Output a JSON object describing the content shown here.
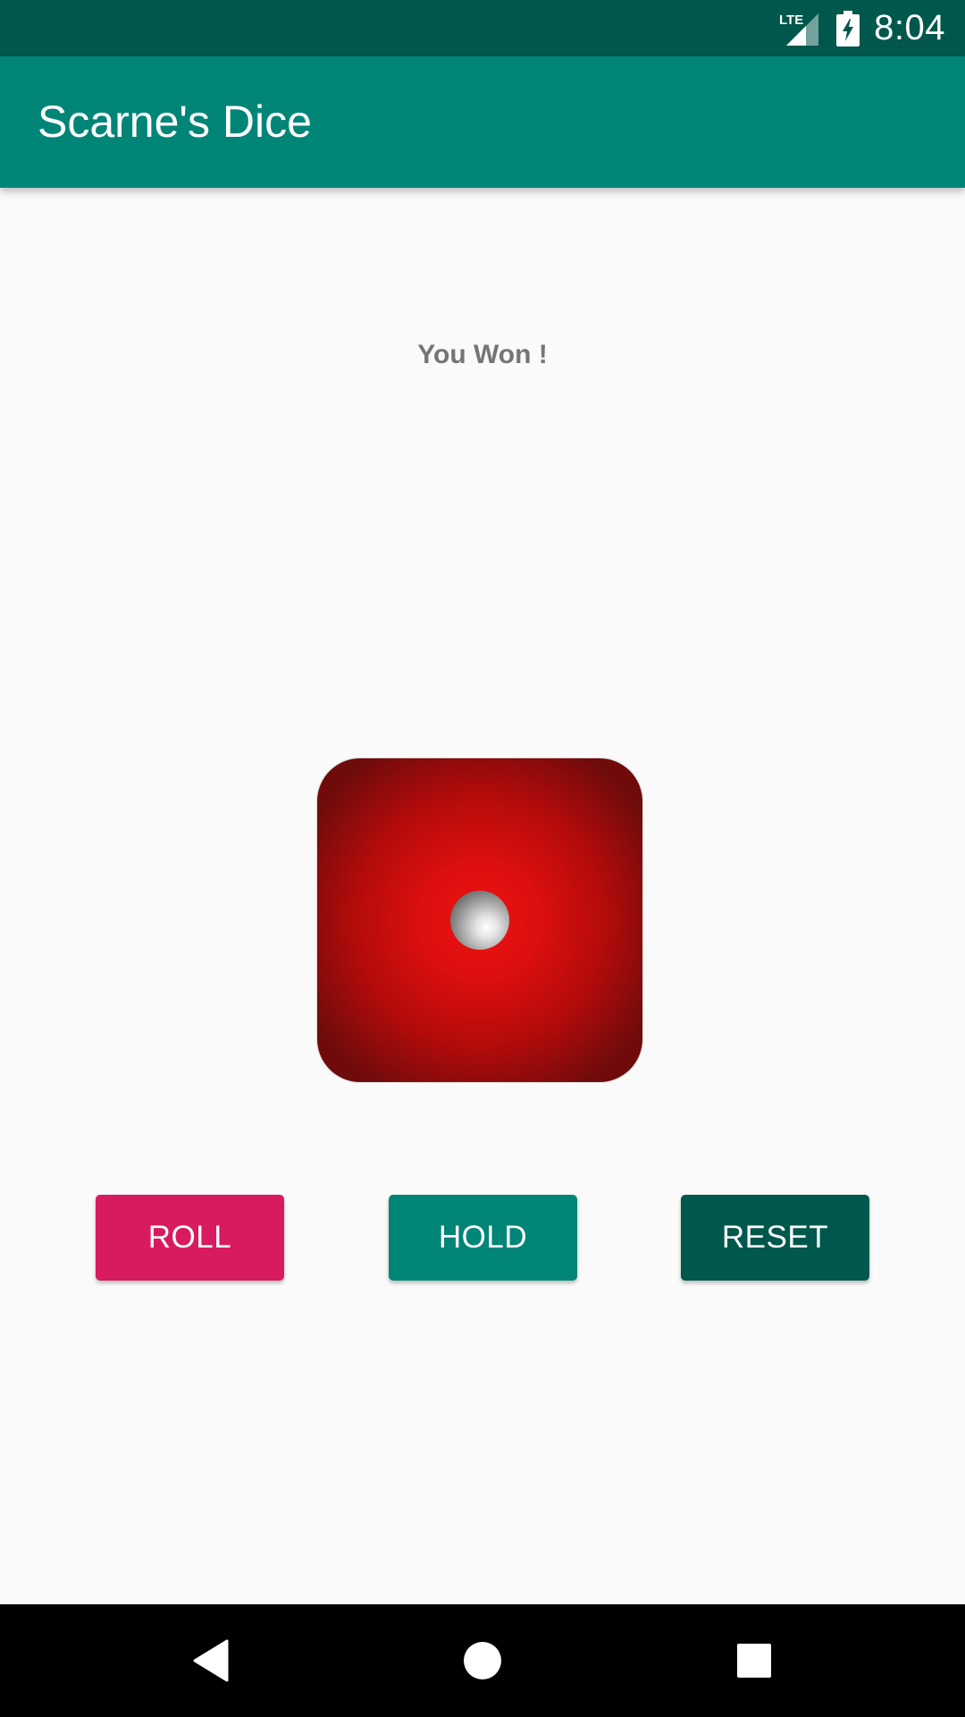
{
  "status_bar": {
    "network_label": "LTE",
    "time": "8:04"
  },
  "app_bar": {
    "title": "Scarne's Dice"
  },
  "game": {
    "status_message": "You Won !",
    "die_face": 1,
    "die_color": "#e01010"
  },
  "buttons": {
    "roll": "ROLL",
    "hold": "HOLD",
    "reset": "RESET"
  },
  "nav_bar": {
    "back_icon": "back-triangle",
    "home_icon": "home-circle",
    "recents_icon": "recents-square"
  },
  "colors": {
    "status_bar": "#00574b",
    "primary": "#008577",
    "accent": "#d81b60",
    "primary_dark": "#00574b"
  }
}
